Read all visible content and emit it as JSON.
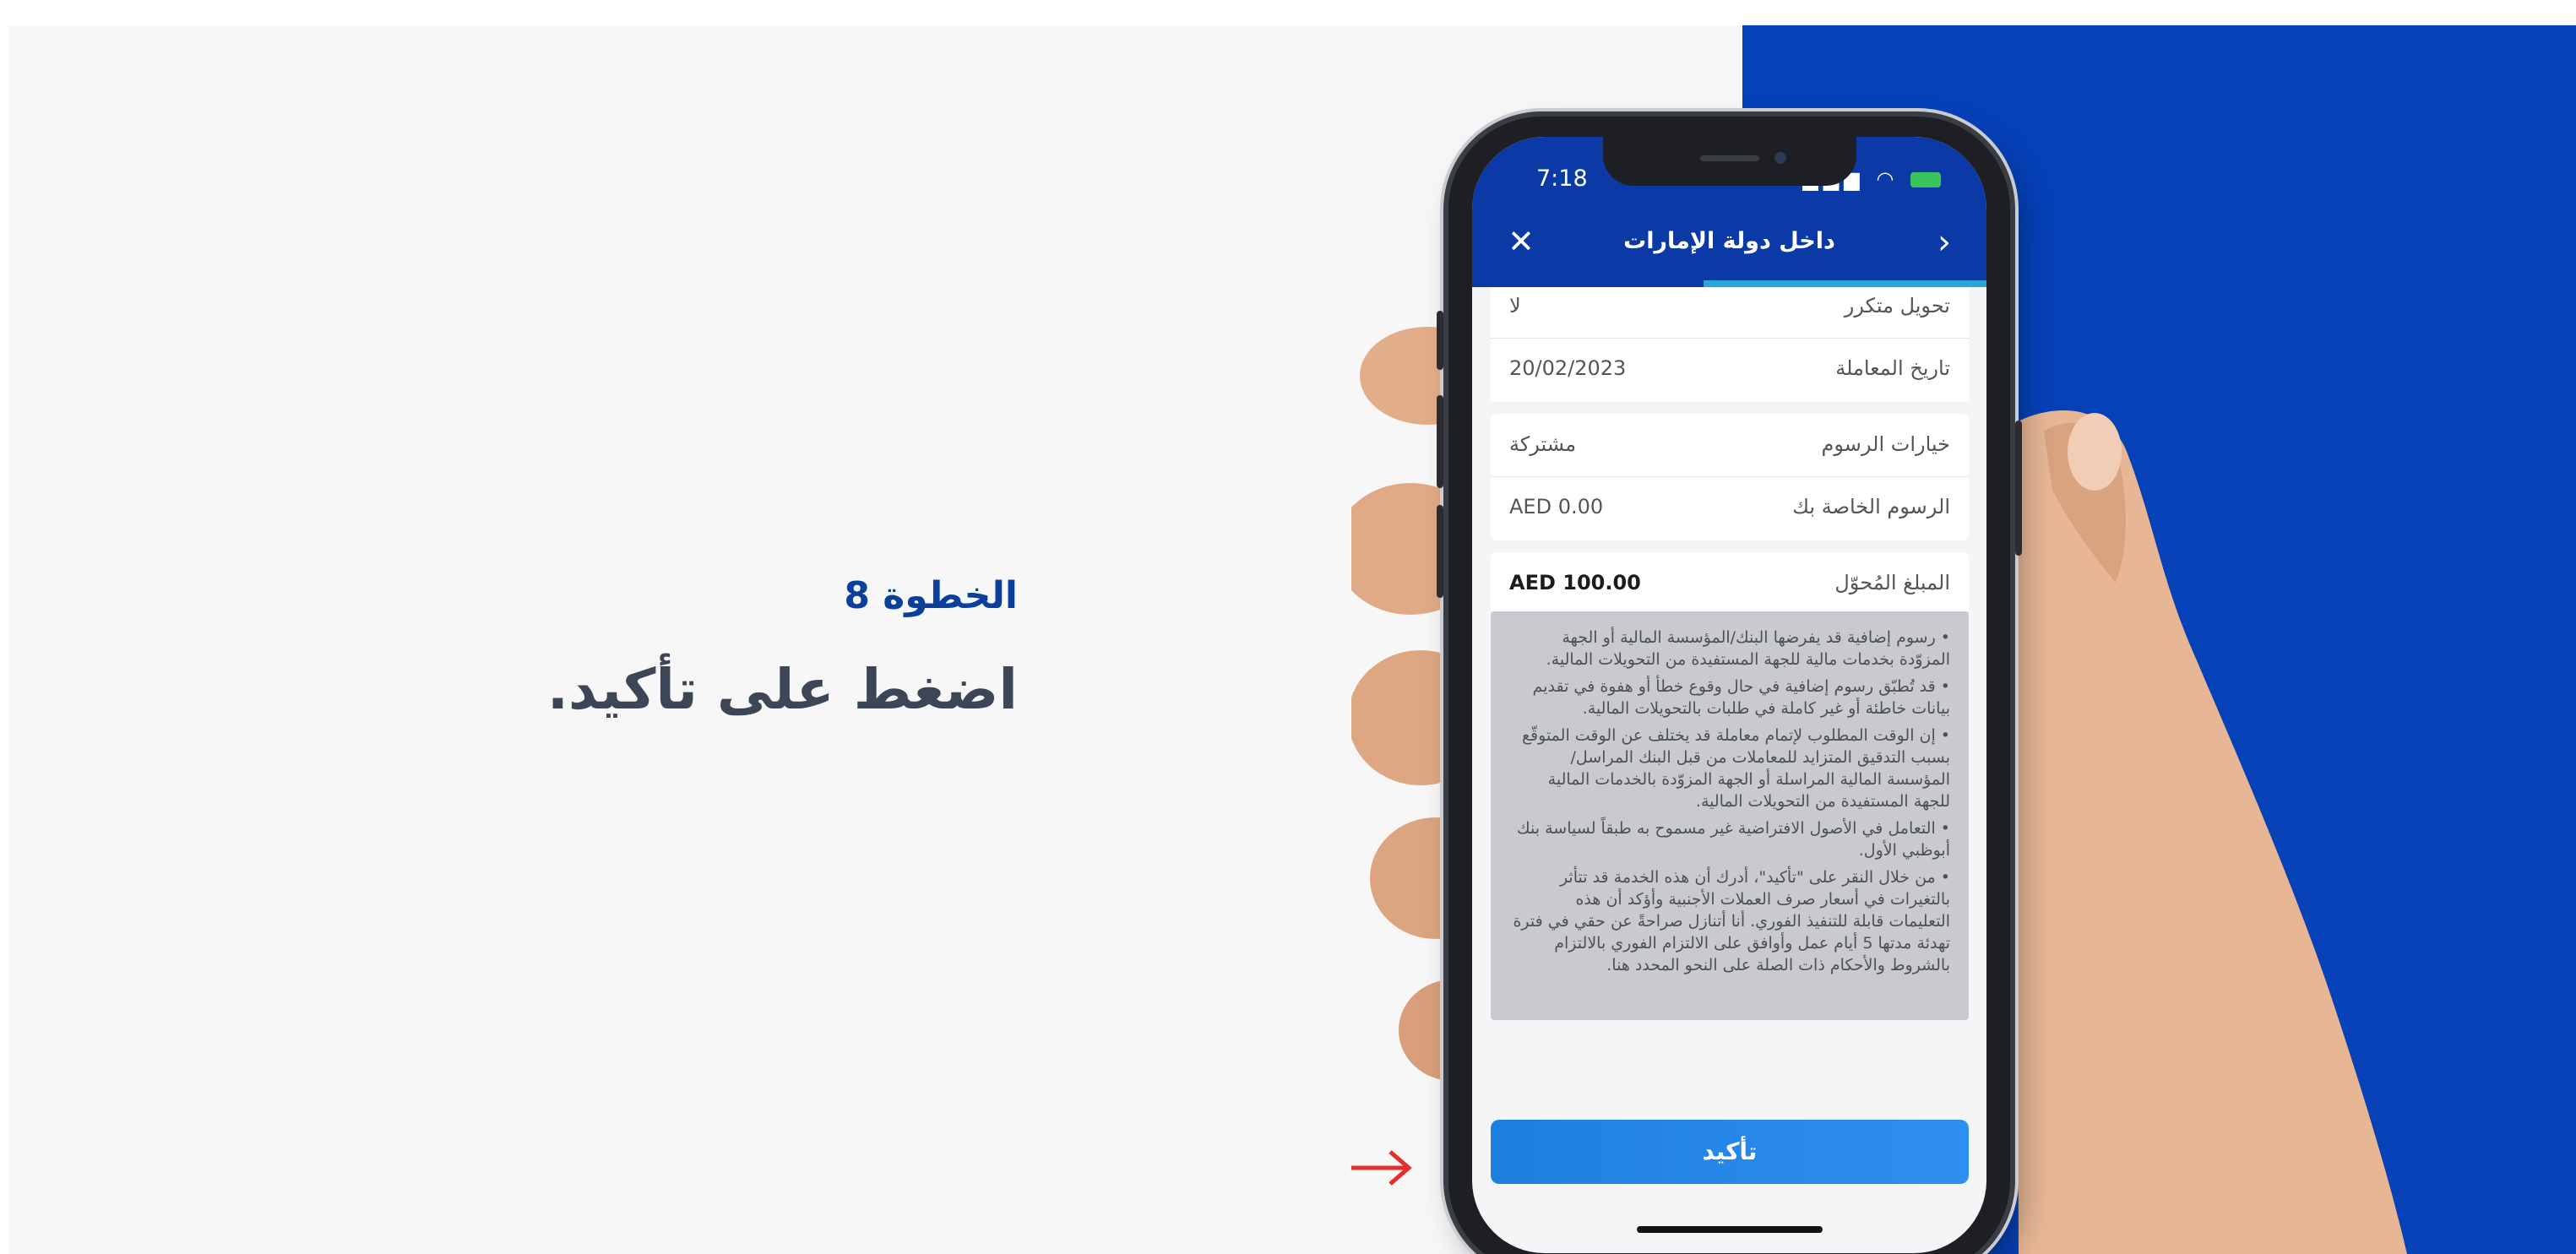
{
  "step": {
    "label": "الخطوة 8",
    "instruction": "اضغط على تأكيد."
  },
  "status_bar": {
    "time": "7:18"
  },
  "nav": {
    "title": "داخل دولة الإمارات",
    "close_icon": "close-icon",
    "back_icon": "chevron-right-icon"
  },
  "details": {
    "recurring_transfer": {
      "label": "تحويل متكرر",
      "value": "لا"
    },
    "transaction_date": {
      "label": "تاريخ المعاملة",
      "value": "20/02/2023"
    },
    "fee_options": {
      "label": "خيارات الرسوم",
      "value": "مشتركة"
    },
    "your_fees": {
      "label": "الرسوم الخاصة بك",
      "value": "AED 0.00"
    },
    "transfer_amount": {
      "label": "المبلغ المُحوّل",
      "value": "AED 100.00"
    }
  },
  "disclaimer": {
    "items": [
      "رسوم إضافية قد يفرضها البنك/المؤسسة المالية أو الجهة المزوّدة بخدمات مالية للجهة المستفيدة من التحويلات المالية.",
      "قد تُطبّق رسوم إضافية في حال وقوع خطأ أو هفوة في تقديم بيانات خاطئة أو غير كاملة في طلبات بالتحويلات المالية.",
      "إن الوقت المطلوب لإتمام معاملة قد يختلف عن الوقت المتوقّع بسبب التدقيق المتزايد للمعاملات من قبل البنك المراسل/المؤسسة المالية المراسلة أو الجهة المزوّدة بالخدمات المالية للجهة المستفيدة من التحويلات المالية.",
      "التعامل في الأصول الافتراضية غير مسموح به طبقاً لسياسة بنك أبوظبي الأول.",
      "من خلال النقر على \"تأكيد\"، أدرك أن هذه الخدمة قد تتأثر بالتغيرات في أسعار صرف العملات الأجنبية وأؤكد أن هذه التعليمات قابلة للتنفيذ الفوري. أنا أتنازل صراحةً عن حقي في فترة تهدئة مدتها 5 أيام عمل وأوافق على الالتزام الفوري بالالتزام بالشروط والأحكام ذات الصلة على النحو المحدد هنا."
    ]
  },
  "confirm_button": {
    "label": "تأكيد"
  },
  "progress": {
    "fraction": 0.55
  },
  "colors": {
    "brand_blue": "#0b3aa6",
    "panel_blue": "#0641b8",
    "button_blue": "#2f8ff0",
    "arrow_red": "#e3302b",
    "step_label": "#0a3f9c"
  }
}
